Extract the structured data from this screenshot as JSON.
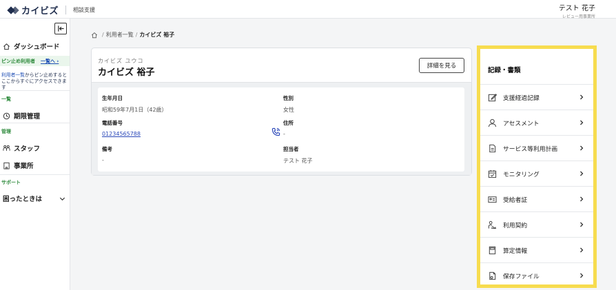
{
  "header": {
    "brand_name": "カイビズ",
    "app_name": "相談支援",
    "user_name": "テスト 花子",
    "user_office": "レビュー用事業所"
  },
  "sidebar": {
    "dashboard": "ダッシュボード",
    "pin": {
      "label": "ピン止め利用者",
      "link": "一覧へ ›",
      "desc_link": "利用者一覧",
      "desc_rest": "からピン止めするとここからすぐにアクセスできます"
    },
    "section_list": "一覧",
    "period_mgmt": "期限管理",
    "section_admin": "管理",
    "staff": "スタッフ",
    "office": "事業所",
    "section_support": "サポート",
    "help": "困ったときは"
  },
  "breadcrumb": {
    "list": "利用者一覧",
    "separator": "/",
    "current": "カイビズ 裕子"
  },
  "profile": {
    "kana": "カイビズ ユウコ",
    "name": "カイビズ 裕子",
    "detail_button": "詳細を見る",
    "fields": {
      "birth_label": "生年月日",
      "birth_value": "昭和59年7月1日（42歳）",
      "gender_label": "性別",
      "gender_value": "女性",
      "phone_label": "電話番号",
      "phone_value": "01234565788",
      "address_label": "住所",
      "address_value": "-",
      "note_label": "備考",
      "note_value": "-",
      "staff_label": "担当者",
      "staff_value": "テスト 花子"
    }
  },
  "records": {
    "title": "記録・書類",
    "items": [
      {
        "label": "支援経過記録",
        "icon": "edit-icon"
      },
      {
        "label": "アセスメント",
        "icon": "person-icon"
      },
      {
        "label": "サービス等利用計画",
        "icon": "document-icon"
      },
      {
        "label": "モニタリング",
        "icon": "calendar-check-icon"
      },
      {
        "label": "受給者証",
        "icon": "id-card-icon"
      },
      {
        "label": "利用契約",
        "icon": "signature-icon"
      },
      {
        "label": "算定情報",
        "icon": "calculator-icon"
      },
      {
        "label": "保存ファイル",
        "icon": "file-icon"
      }
    ]
  },
  "colors": {
    "brand": "#1f2d4d",
    "accent_green": "#2e8a3c",
    "link_blue": "#2a47b8",
    "highlight_yellow": "#f7dc4f"
  }
}
